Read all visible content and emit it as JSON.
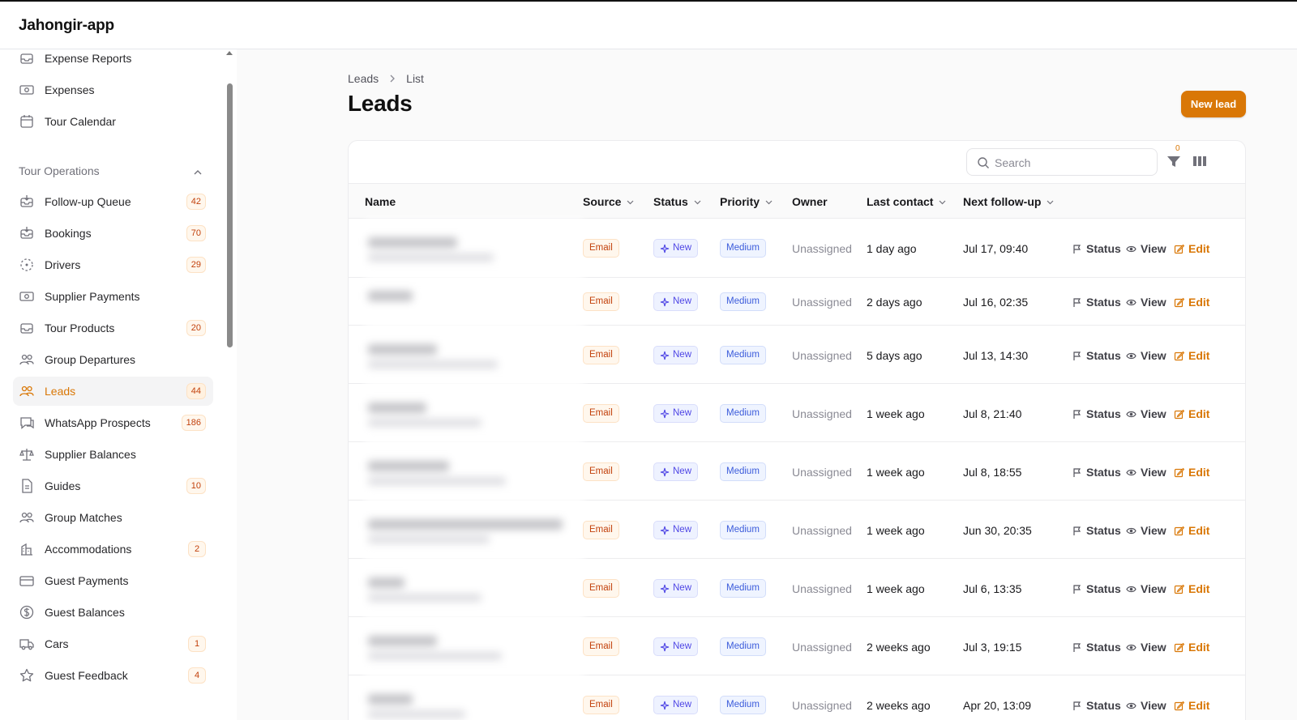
{
  "app": {
    "title": "Jahongir-app"
  },
  "sidebar": {
    "top_items": [
      {
        "label": "Expense Reports",
        "icon": "inbox-icon"
      },
      {
        "label": "Expenses",
        "icon": "banknote-icon"
      },
      {
        "label": "Tour Calendar",
        "icon": "calendar-icon"
      }
    ],
    "group_title": "Tour Operations",
    "items": [
      {
        "label": "Follow-up Queue",
        "badge": "42",
        "icon": "inbox-arrow-icon"
      },
      {
        "label": "Bookings",
        "badge": "70",
        "icon": "inbox-arrow-icon"
      },
      {
        "label": "Drivers",
        "badge": "29",
        "icon": "dashed-circle-icon"
      },
      {
        "label": "Supplier Payments",
        "badge": "",
        "icon": "banknote-icon"
      },
      {
        "label": "Tour Products",
        "badge": "20",
        "icon": "inbox-icon"
      },
      {
        "label": "Group Departures",
        "badge": "",
        "icon": "users-icon"
      },
      {
        "label": "Leads",
        "badge": "44",
        "icon": "users-icon",
        "active": true
      },
      {
        "label": "WhatsApp Prospects",
        "badge": "186",
        "icon": "chat-icon"
      },
      {
        "label": "Supplier Balances",
        "badge": "",
        "icon": "scale-icon"
      },
      {
        "label": "Guides",
        "badge": "10",
        "icon": "document-icon"
      },
      {
        "label": "Group Matches",
        "badge": "",
        "icon": "users-icon"
      },
      {
        "label": "Accommodations",
        "badge": "2",
        "icon": "building-icon"
      },
      {
        "label": "Guest Payments",
        "badge": "",
        "icon": "credit-card-icon"
      },
      {
        "label": "Guest Balances",
        "badge": "",
        "icon": "dollar-circle-icon"
      },
      {
        "label": "Cars",
        "badge": "1",
        "icon": "truck-icon"
      },
      {
        "label": "Guest Feedback",
        "badge": "4",
        "icon": "star-icon"
      }
    ]
  },
  "main": {
    "breadcrumb": [
      "Leads",
      "List"
    ],
    "title": "Leads",
    "new_button": "New lead",
    "search_placeholder": "Search",
    "filter_count": "0",
    "columns": [
      "Name",
      "Source",
      "Status",
      "Priority",
      "Owner",
      "Last contact",
      "Next follow-up"
    ],
    "action_labels": {
      "status": "Status",
      "view": "View",
      "edit": "Edit"
    },
    "rows": [
      {
        "source": "Email",
        "status": "New",
        "priority": "Medium",
        "owner": "Unassigned",
        "last_contact": "1 day ago",
        "next_follow_up": "Jul 17, 09:40"
      },
      {
        "source": "Email",
        "status": "New",
        "priority": "Medium",
        "owner": "Unassigned",
        "last_contact": "2 days ago",
        "next_follow_up": "Jul 16, 02:35"
      },
      {
        "source": "Email",
        "status": "New",
        "priority": "Medium",
        "owner": "Unassigned",
        "last_contact": "5 days ago",
        "next_follow_up": "Jul 13, 14:30"
      },
      {
        "source": "Email",
        "status": "New",
        "priority": "Medium",
        "owner": "Unassigned",
        "last_contact": "1 week ago",
        "next_follow_up": "Jul 8, 21:40"
      },
      {
        "source": "Email",
        "status": "New",
        "priority": "Medium",
        "owner": "Unassigned",
        "last_contact": "1 week ago",
        "next_follow_up": "Jul 8, 18:55"
      },
      {
        "source": "Email",
        "status": "New",
        "priority": "Medium",
        "owner": "Unassigned",
        "last_contact": "1 week ago",
        "next_follow_up": "Jun 30, 20:35"
      },
      {
        "source": "Email",
        "status": "New",
        "priority": "Medium",
        "owner": "Unassigned",
        "last_contact": "1 week ago",
        "next_follow_up": "Jul 6, 13:35"
      },
      {
        "source": "Email",
        "status": "New",
        "priority": "Medium",
        "owner": "Unassigned",
        "last_contact": "2 weeks ago",
        "next_follow_up": "Jul 3, 19:15"
      },
      {
        "source": "Email",
        "status": "New",
        "priority": "Medium",
        "owner": "Unassigned",
        "last_contact": "2 weeks ago",
        "next_follow_up": "Apr 20, 13:09"
      }
    ]
  },
  "colors": {
    "accent": "#d97706",
    "status_badge": "#4f46e5",
    "priority_badge": "#3b5bdb"
  }
}
